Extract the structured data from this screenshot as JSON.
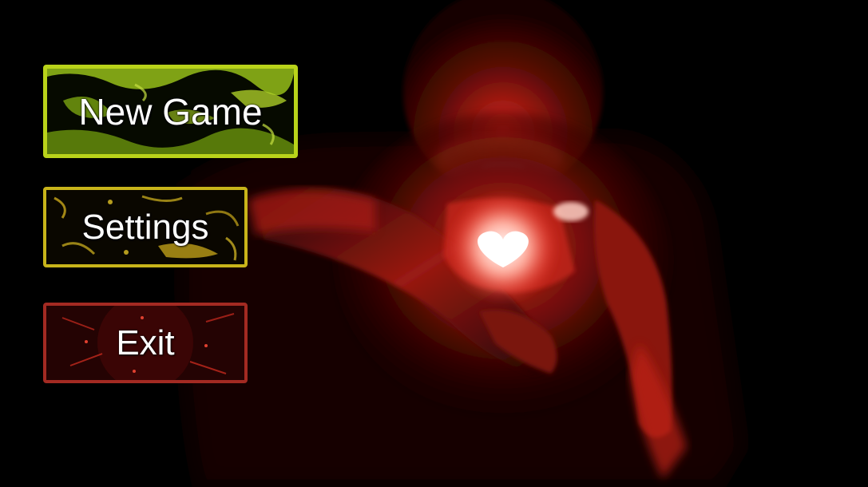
{
  "menu": {
    "new_game_label": "New Game",
    "settings_label": "Settings",
    "exit_label": "Exit"
  },
  "colors": {
    "background": "#000000",
    "new_game_border": "#b9d31a",
    "settings_border": "#c8b41a",
    "exit_border": "#a32a22",
    "glow_red": "#e0281c",
    "heart_glow": "#ffffff"
  },
  "artwork": {
    "subject": "glowing-red-figure-holding-heart"
  }
}
